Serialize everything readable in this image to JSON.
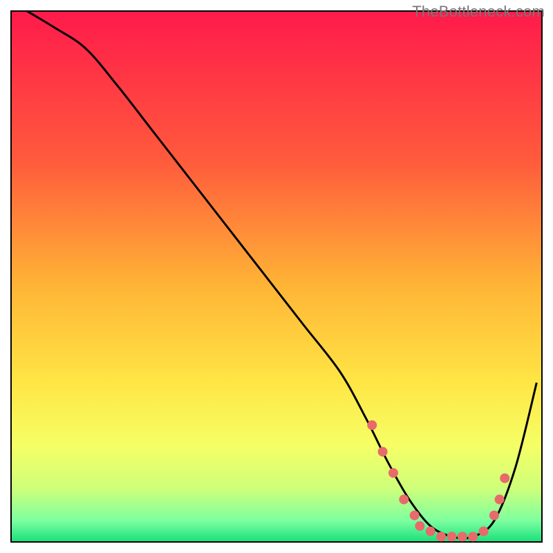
{
  "attribution": "TheBottleneck.com",
  "chart_data": {
    "type": "line",
    "title": "",
    "xlabel": "",
    "ylabel": "",
    "xlim": [
      0,
      100
    ],
    "ylim": [
      0,
      100
    ],
    "grid": false,
    "legend": false,
    "gradient_stops": [
      {
        "pct": 0,
        "color": "#ff1a4b"
      },
      {
        "pct": 28,
        "color": "#ff5a3c"
      },
      {
        "pct": 52,
        "color": "#ffb536"
      },
      {
        "pct": 70,
        "color": "#ffe645"
      },
      {
        "pct": 82,
        "color": "#f5ff66"
      },
      {
        "pct": 90,
        "color": "#ceff7a"
      },
      {
        "pct": 96,
        "color": "#7dffa0"
      },
      {
        "pct": 100,
        "color": "#18e07a"
      }
    ],
    "series": [
      {
        "name": "bottleneck-curve",
        "x": [
          3,
          8,
          14,
          20,
          27,
          34,
          41,
          48,
          55,
          62,
          67,
          71,
          75,
          79,
          83,
          87,
          91,
          95,
          99
        ],
        "values": [
          100,
          97,
          93,
          86,
          77,
          68,
          59,
          50,
          41,
          32,
          23,
          15,
          8,
          3,
          1,
          1,
          4,
          14,
          30
        ]
      }
    ],
    "markers": {
      "name": "highlighted-points",
      "color": "#e86a6a",
      "points": [
        {
          "x": 68,
          "y": 22
        },
        {
          "x": 70,
          "y": 17
        },
        {
          "x": 72,
          "y": 13
        },
        {
          "x": 74,
          "y": 8
        },
        {
          "x": 76,
          "y": 5
        },
        {
          "x": 77,
          "y": 3
        },
        {
          "x": 79,
          "y": 2
        },
        {
          "x": 81,
          "y": 1
        },
        {
          "x": 83,
          "y": 1
        },
        {
          "x": 85,
          "y": 1
        },
        {
          "x": 87,
          "y": 1
        },
        {
          "x": 89,
          "y": 2
        },
        {
          "x": 91,
          "y": 5
        },
        {
          "x": 92,
          "y": 8
        },
        {
          "x": 93,
          "y": 12
        }
      ]
    }
  }
}
